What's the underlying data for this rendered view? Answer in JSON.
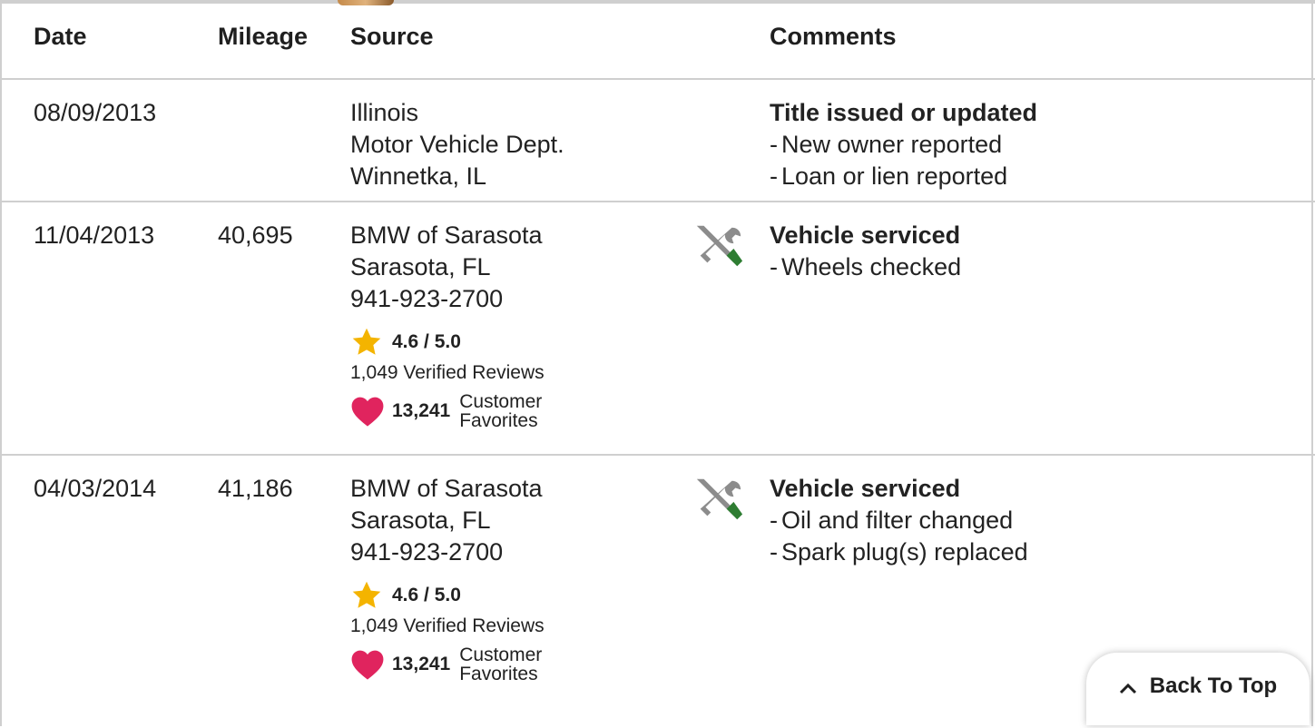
{
  "header": {
    "date": "Date",
    "mileage": "Mileage",
    "source": "Source",
    "comments": "Comments"
  },
  "records": [
    {
      "date": "08/09/2013",
      "mileage": "",
      "source": [
        "Illinois",
        "Motor Vehicle Dept.",
        "Winnetka, IL"
      ],
      "comment_title": "Title issued or updated",
      "comment_items": [
        "New owner reported",
        "Loan or lien reported"
      ]
    },
    {
      "date": "11/04/2013",
      "mileage": "40,695",
      "source": [
        "BMW of Sarasota",
        "Sarasota, FL",
        "941-923-2700"
      ],
      "rating": "4.6 / 5.0",
      "reviews": "1,049 Verified Reviews",
      "favorites_count": "13,241",
      "favorites_label": "Customer Favorites",
      "icon": "service-tools-icon",
      "comment_title": "Vehicle serviced",
      "comment_items": [
        "Wheels checked"
      ]
    },
    {
      "date": "04/03/2014",
      "mileage": "41,186",
      "source": [
        "BMW of Sarasota",
        "Sarasota, FL",
        "941-923-2700"
      ],
      "rating": "4.6 / 5.0",
      "reviews": "1,049 Verified Reviews",
      "favorites_count": "13,241",
      "favorites_label": "Customer Favorites",
      "icon": "service-tools-icon",
      "comment_title": "Vehicle serviced",
      "comment_items": [
        "Oil and filter changed",
        "Spark plug(s) replaced"
      ]
    }
  ],
  "back_to_top": {
    "label": "Back To Top",
    "icon": "chevron-up-icon"
  },
  "colors": {
    "star": "#f4b400",
    "heart": "#e0245e",
    "wrench": "#8c8c8c",
    "screwdriver": "#2e7d32",
    "divider": "#cfcfcf"
  }
}
